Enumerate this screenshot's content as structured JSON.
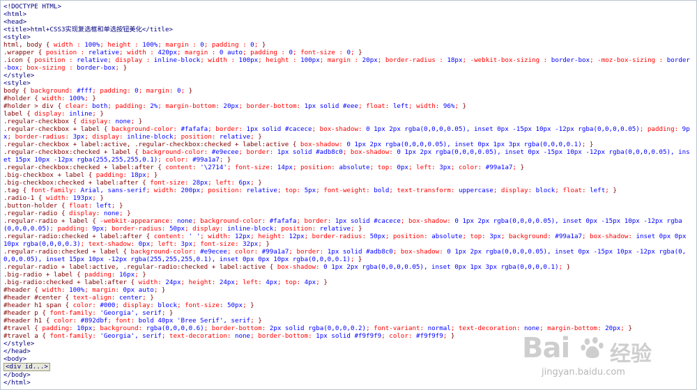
{
  "code_lines": [
    "<!DOCTYPE HTML>",
    "<html>",
    "<head>",
    "<title>html+CSS3实现复选框和单选按钮美化</title>",
    "<style>",
    "html, body { width : 100%; height : 100%; margin : 0; padding : 0; }",
    ".wrapper { position : relative; width : 420px; margin : 0 auto; padding : 0; font-size : 0; }",
    ".icon { position : relative; display : inline-block; width : 100px; height : 100px; margin : 20px; border-radius : 18px; -webkit-box-sizing : border-box; -moz-box-sizing : border-box; box-sizing : border-box; }",
    "</style>",
    "<style>",
    "body { background: #fff; padding: 0; margin: 0; }",
    "#holder { width: 100%; }",
    "#holder > div { clear: both; padding: 2%; margin-bottom: 20px; border-bottom: 1px solid #eee; float: left; width: 96%; }",
    "label { display: inline; }",
    ".regular-checkbox { display: none; }",
    ".regular-checkbox + label { background-color: #fafafa; border: 1px solid #cacece; box-shadow: 0 1px 2px rgba(0,0,0,0.05), inset 0px -15px 10px -12px rgba(0,0,0,0.05); padding: 9px; border-radius: 3px; display: inline-block; position: relative; }",
    ".regular-checkbox + label:active, .regular-checkbox:checked + label:active { box-shadow: 0 1px 2px rgba(0,0,0,0.05), inset 0px 1px 3px rgba(0,0,0,0.1); }",
    ".regular-checkbox:checked + label { background-color: #e9ecee; border: 1px solid #adb8c0; box-shadow: 0 1px 2px rgba(0,0,0,0.05), inset 0px -15px 10px -12px rgba(0,0,0,0.05), inset 15px 10px -12px rgba(255,255,255,0.1); color: #99a1a7; }",
    ".regular-checkbox:checked + label:after { content: '\\2714'; font-size: 14px; position: absolute; top: 0px; left: 3px; color: #99a1a7; }",
    ".big-checkbox + label { padding: 18px; }",
    ".big-checkbox:checked + label:after { font-size: 28px; left: 6px; }",
    ".tag { font-family: Arial, sans-serif; width: 200px; position: relative; top: 5px; font-weight: bold; text-transform: uppercase; display: block; float: left; }",
    ".radio-1 { width: 193px; }",
    ".button-holder { float: left; }",
    ".regular-radio { display: none; }",
    ".regular-radio + label { -webkit-appearance: none; background-color: #fafafa; border: 1px solid #cacece; box-shadow: 0 1px 2px rgba(0,0,0,0.05), inset 0px -15px 10px -12px rgba(0,0,0,0.05); padding: 9px; border-radius: 50px; display: inline-block; position: relative; }",
    ".regular-radio:checked + label:after { content: ' '; width: 12px; height: 12px; border-radius: 50px; position: absolute; top: 3px; background: #99a1a7; box-shadow: inset 0px 0px 10px rgba(0,0,0,0.3); text-shadow: 0px; left: 3px; font-size: 32px; }",
    ".regular-radio:checked + label { background-color: #e9ecee; color: #99a1a7; border: 1px solid #adb8c0; box-shadow: 0 1px 2px rgba(0,0,0,0.05), inset 0px -15px 10px -12px rgba(0,0,0,0.05), inset 15px 10px -12px rgba(255,255,255,0.1), inset 0px 0px 10px rgba(0,0,0,0.1); }",
    ".regular-radio + label:active, .regular-radio:checked + label:active { box-shadow: 0 1px 2px rgba(0,0,0,0.05), inset 0px 1px 3px rgba(0,0,0,0.1); }",
    ".big-radio + label { padding: 16px; }",
    ".big-radio:checked + label:after { width: 24px; height: 24px; left: 4px; top: 4px; }",
    "#header { width: 100%; margin: 0px auto; }",
    "#header #center { text-align: center; }",
    "#header h1 span { color: #000; display: block; font-size: 50px; }",
    "#header p { font-family: 'Georgia', serif; }",
    "#header h1 { color: #892dbf; font: bold 40px 'Bree Serif', serif; }",
    "#travel { padding: 10px; background: rgba(0,0,0,0.6); border-bottom: 2px solid rgba(0,0,0,0.2); font-variant: normal; text-decoration: none; margin-bottom: 20px; }",
    "#travel a { font-family: 'Georgia', serif; text-decoration: none; border-bottom: 1px solid #f9f9f9; color: #f9f9f9; }",
    "</style>",
    "</head>",
    "<body>",
    "@@COLLAPSED@@",
    "</body>",
    "</html>"
  ],
  "collapsed_node_label": "<div id...>",
  "watermark": {
    "brand": "Bai",
    "brand_cn": "经验",
    "url": "jingyan.baidu.com"
  },
  "colors": {
    "tag": "#000080",
    "selector": "#800000",
    "property": "#ff0000",
    "value": "#0000ff"
  }
}
